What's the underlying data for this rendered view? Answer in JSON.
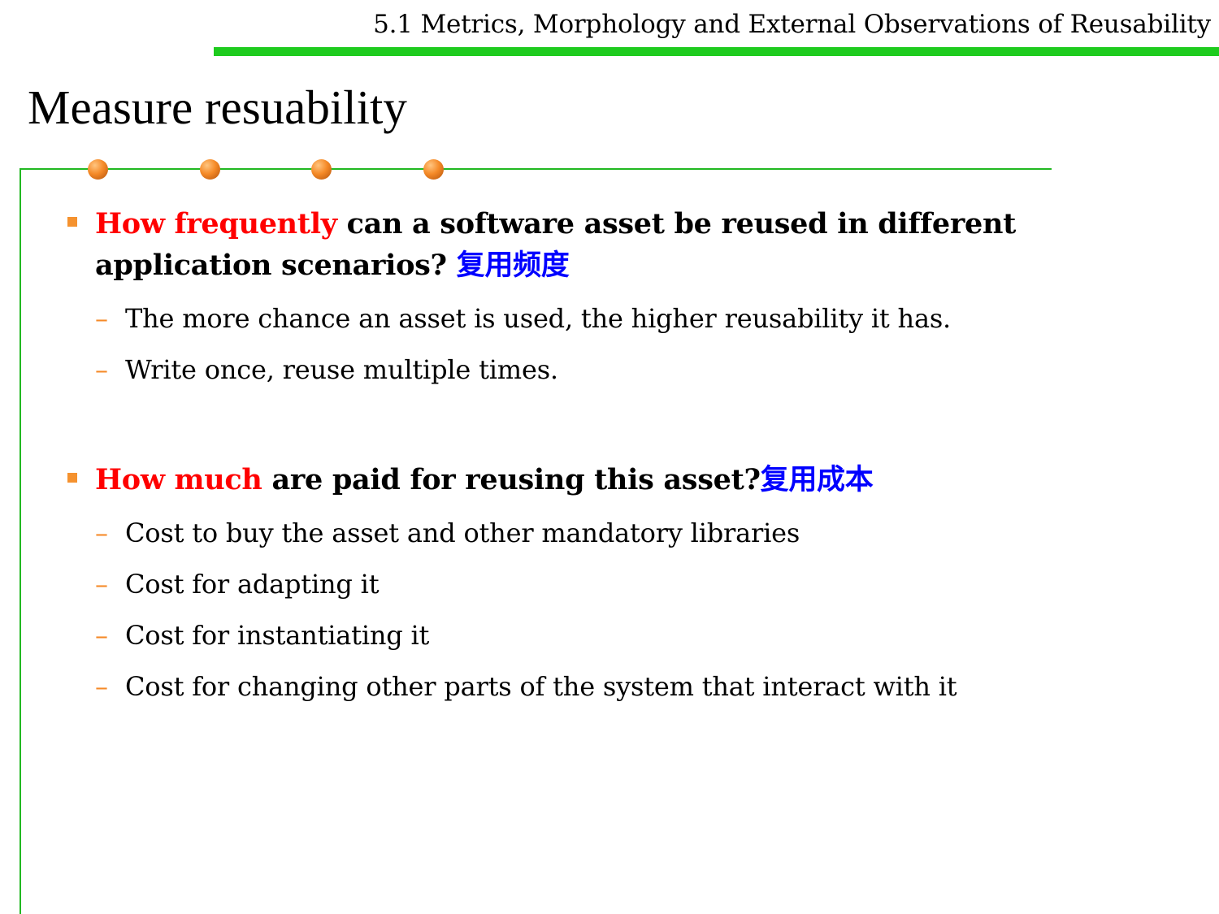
{
  "header": {
    "section_title": "5.1 Metrics, Morphology and External Observations of Reusability"
  },
  "slide": {
    "title": "Measure resuability"
  },
  "points": [
    {
      "highlight": "How frequently",
      "text": " can a software asset be reused in different application scenarios?  ",
      "cjk": "复用频度",
      "sub_items": [
        "The more chance an asset is used, the higher reusability it has.",
        "Write once, reuse multiple times."
      ]
    },
    {
      "highlight": "How much",
      "text": " are paid for reusing this asset?",
      "cjk": "复用成本",
      "sub_items": [
        "Cost to buy the asset and other mandatory libraries",
        "Cost for adapting it",
        "Cost for instantiating it",
        "Cost for changing other parts of the system that interact with it"
      ]
    }
  ],
  "colors": {
    "header_bar": "#1ecb1e",
    "frame_line": "#22b822",
    "highlight": "#ff0000",
    "cjk_text": "#0000ff",
    "bullet": "#f5922f"
  },
  "icons": {
    "main_bullet": "square-bullet-icon",
    "sub_bullet": "dash-bullet",
    "decoration": "orange-ball-icon"
  }
}
